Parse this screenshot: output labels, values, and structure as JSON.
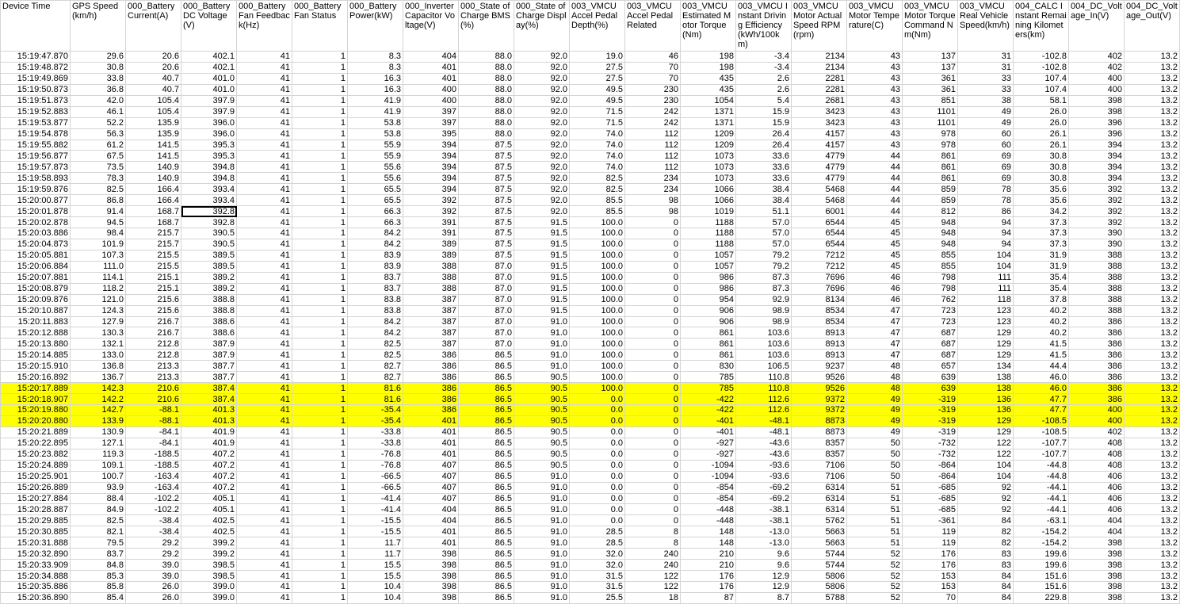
{
  "sheet": {
    "headers": [
      "Device Time",
      "GPS Speed(km/h)",
      "000_Battery Current(A)",
      "000_Battery DC Voltage(V)",
      "000_Battery Fan Feedback(Hz)",
      "000_Battery Fan Status",
      "000_Battery Power(kW)",
      "000_Inverter Capacitor Voltage(V)",
      "000_State of Charge BMS(%)",
      "000_State of Charge Display(%)",
      "003_VMCU Accel Pedal Depth(%)",
      "003_VMCU Accel Pedal Related",
      "003_VMCU Estimated Motor Torque(Nm)",
      "003_VMCU Instant Driving Efficiency(kWh/100km)",
      "003_VMCU Motor Actual Speed RPM(rpm)",
      "003_VMCU Motor Temperature(C)",
      "003_VMCU Motor Torque Command Nm(Nm)",
      "003_VMCU Real Vehicle Speed(km/h)",
      "004_CALC Instant Remaining Kilometers(km)",
      "004_DC_Voltage_In(V)",
      "004_DC_Voltage_Out(V)"
    ],
    "highlight_color": "#ffff00",
    "highlighted_rows": [
      30,
      31,
      32,
      33
    ],
    "selected_cell": {
      "row": 14,
      "col": 3
    },
    "rows": [
      [
        "15:19:47.870",
        "29.6",
        "20.6",
        "402.1",
        "41",
        "1",
        "8.3",
        "404",
        "88.0",
        "92.0",
        "19.0",
        "46",
        "198",
        "-3.4",
        "2134",
        "43",
        "137",
        "31",
        "-102.8",
        "402",
        "13.2"
      ],
      [
        "15:19:48.872",
        "30.8",
        "20.6",
        "402.1",
        "41",
        "1",
        "8.3",
        "401",
        "88.0",
        "92.0",
        "27.5",
        "70",
        "198",
        "-3.4",
        "2134",
        "43",
        "137",
        "31",
        "-102.8",
        "402",
        "13.2"
      ],
      [
        "15:19:49.869",
        "33.8",
        "40.7",
        "401.0",
        "41",
        "1",
        "16.3",
        "401",
        "88.0",
        "92.0",
        "27.5",
        "70",
        "435",
        "2.6",
        "2281",
        "43",
        "361",
        "33",
        "107.4",
        "400",
        "13.2"
      ],
      [
        "15:19:50.873",
        "36.8",
        "40.7",
        "401.0",
        "41",
        "1",
        "16.3",
        "400",
        "88.0",
        "92.0",
        "49.5",
        "230",
        "435",
        "2.6",
        "2281",
        "43",
        "361",
        "33",
        "107.4",
        "400",
        "13.2"
      ],
      [
        "15:19:51.873",
        "42.0",
        "105.4",
        "397.9",
        "41",
        "1",
        "41.9",
        "400",
        "88.0",
        "92.0",
        "49.5",
        "230",
        "1054",
        "5.4",
        "2681",
        "43",
        "851",
        "38",
        "58.1",
        "398",
        "13.2"
      ],
      [
        "15:19:52.883",
        "46.1",
        "105.4",
        "397.9",
        "41",
        "1",
        "41.9",
        "397",
        "88.0",
        "92.0",
        "71.5",
        "242",
        "1371",
        "15.9",
        "3423",
        "43",
        "1101",
        "49",
        "26.0",
        "398",
        "13.2"
      ],
      [
        "15:19:53.877",
        "52.2",
        "135.9",
        "396.0",
        "41",
        "1",
        "53.8",
        "397",
        "88.0",
        "92.0",
        "71.5",
        "242",
        "1371",
        "15.9",
        "3423",
        "43",
        "1101",
        "49",
        "26.0",
        "396",
        "13.2"
      ],
      [
        "15:19:54.878",
        "56.3",
        "135.9",
        "396.0",
        "41",
        "1",
        "53.8",
        "395",
        "88.0",
        "92.0",
        "74.0",
        "112",
        "1209",
        "26.4",
        "4157",
        "43",
        "978",
        "60",
        "26.1",
        "396",
        "13.2"
      ],
      [
        "15:19:55.882",
        "61.2",
        "141.5",
        "395.3",
        "41",
        "1",
        "55.9",
        "394",
        "87.5",
        "92.0",
        "74.0",
        "112",
        "1209",
        "26.4",
        "4157",
        "43",
        "978",
        "60",
        "26.1",
        "394",
        "13.2"
      ],
      [
        "15:19:56.877",
        "67.5",
        "141.5",
        "395.3",
        "41",
        "1",
        "55.9",
        "394",
        "87.5",
        "92.0",
        "74.0",
        "112",
        "1073",
        "33.6",
        "4779",
        "44",
        "861",
        "69",
        "30.8",
        "394",
        "13.2"
      ],
      [
        "15:19:57.873",
        "73.5",
        "140.9",
        "394.8",
        "41",
        "1",
        "55.6",
        "394",
        "87.5",
        "92.0",
        "74.0",
        "112",
        "1073",
        "33.6",
        "4779",
        "44",
        "861",
        "69",
        "30.8",
        "394",
        "13.2"
      ],
      [
        "15:19:58.893",
        "78.3",
        "140.9",
        "394.8",
        "41",
        "1",
        "55.6",
        "394",
        "87.5",
        "92.0",
        "82.5",
        "234",
        "1073",
        "33.6",
        "4779",
        "44",
        "861",
        "69",
        "30.8",
        "394",
        "13.2"
      ],
      [
        "15:19:59.876",
        "82.5",
        "166.4",
        "393.4",
        "41",
        "1",
        "65.5",
        "394",
        "87.5",
        "92.0",
        "82.5",
        "234",
        "1066",
        "38.4",
        "5468",
        "44",
        "859",
        "78",
        "35.6",
        "392",
        "13.2"
      ],
      [
        "15:20:00.877",
        "86.8",
        "166.4",
        "393.4",
        "41",
        "1",
        "65.5",
        "392",
        "87.5",
        "92.0",
        "85.5",
        "98",
        "1066",
        "38.4",
        "5468",
        "44",
        "859",
        "78",
        "35.6",
        "392",
        "13.2"
      ],
      [
        "15:20:01.878",
        "91.4",
        "168.7",
        "392.8",
        "41",
        "1",
        "66.3",
        "392",
        "87.5",
        "92.0",
        "85.5",
        "98",
        "1019",
        "51.1",
        "6001",
        "44",
        "812",
        "86",
        "34.2",
        "392",
        "13.2"
      ],
      [
        "15:20:02.878",
        "94.5",
        "168.7",
        "392.8",
        "41",
        "1",
        "66.3",
        "391",
        "87.5",
        "91.5",
        "100.0",
        "0",
        "1188",
        "57.0",
        "6544",
        "45",
        "948",
        "94",
        "37.3",
        "392",
        "13.2"
      ],
      [
        "15:20:03.886",
        "98.4",
        "215.7",
        "390.5",
        "41",
        "1",
        "84.2",
        "391",
        "87.5",
        "91.5",
        "100.0",
        "0",
        "1188",
        "57.0",
        "6544",
        "45",
        "948",
        "94",
        "37.3",
        "390",
        "13.2"
      ],
      [
        "15:20:04.873",
        "101.9",
        "215.7",
        "390.5",
        "41",
        "1",
        "84.2",
        "389",
        "87.5",
        "91.5",
        "100.0",
        "0",
        "1188",
        "57.0",
        "6544",
        "45",
        "948",
        "94",
        "37.3",
        "390",
        "13.2"
      ],
      [
        "15:20:05.881",
        "107.3",
        "215.5",
        "389.5",
        "41",
        "1",
        "83.9",
        "389",
        "87.5",
        "91.5",
        "100.0",
        "0",
        "1057",
        "79.2",
        "7212",
        "45",
        "855",
        "104",
        "31.9",
        "388",
        "13.2"
      ],
      [
        "15:20:06.884",
        "111.0",
        "215.5",
        "389.5",
        "41",
        "1",
        "83.9",
        "388",
        "87.0",
        "91.5",
        "100.0",
        "0",
        "1057",
        "79.2",
        "7212",
        "45",
        "855",
        "104",
        "31.9",
        "388",
        "13.2"
      ],
      [
        "15:20:07.881",
        "114.1",
        "215.1",
        "389.2",
        "41",
        "1",
        "83.7",
        "388",
        "87.0",
        "91.5",
        "100.0",
        "0",
        "986",
        "87.3",
        "7696",
        "46",
        "798",
        "111",
        "35.4",
        "388",
        "13.2"
      ],
      [
        "15:20:08.879",
        "118.2",
        "215.1",
        "389.2",
        "41",
        "1",
        "83.7",
        "388",
        "87.0",
        "91.5",
        "100.0",
        "0",
        "986",
        "87.3",
        "7696",
        "46",
        "798",
        "111",
        "35.4",
        "388",
        "13.2"
      ],
      [
        "15:20:09.876",
        "121.0",
        "215.6",
        "388.8",
        "41",
        "1",
        "83.8",
        "387",
        "87.0",
        "91.5",
        "100.0",
        "0",
        "954",
        "92.9",
        "8134",
        "46",
        "762",
        "118",
        "37.8",
        "388",
        "13.2"
      ],
      [
        "15:20:10.887",
        "124.3",
        "215.6",
        "388.8",
        "41",
        "1",
        "83.8",
        "387",
        "87.0",
        "91.5",
        "100.0",
        "0",
        "906",
        "98.9",
        "8534",
        "47",
        "723",
        "123",
        "40.2",
        "388",
        "13.2"
      ],
      [
        "15:20:11.883",
        "127.9",
        "216.7",
        "388.6",
        "41",
        "1",
        "84.2",
        "387",
        "87.0",
        "91.0",
        "100.0",
        "0",
        "906",
        "98.9",
        "8534",
        "47",
        "723",
        "123",
        "40.2",
        "386",
        "13.2"
      ],
      [
        "15:20:12.888",
        "130.3",
        "216.7",
        "388.6",
        "41",
        "1",
        "84.2",
        "387",
        "87.0",
        "91.0",
        "100.0",
        "0",
        "861",
        "103.6",
        "8913",
        "47",
        "687",
        "129",
        "40.2",
        "386",
        "13.2"
      ],
      [
        "15:20:13.880",
        "132.1",
        "212.8",
        "387.9",
        "41",
        "1",
        "82.5",
        "387",
        "87.0",
        "91.0",
        "100.0",
        "0",
        "861",
        "103.6",
        "8913",
        "47",
        "687",
        "129",
        "41.5",
        "386",
        "13.2"
      ],
      [
        "15:20:14.885",
        "133.0",
        "212.8",
        "387.9",
        "41",
        "1",
        "82.5",
        "386",
        "86.5",
        "91.0",
        "100.0",
        "0",
        "861",
        "103.6",
        "8913",
        "47",
        "687",
        "129",
        "41.5",
        "386",
        "13.2"
      ],
      [
        "15:20:15.910",
        "136.8",
        "213.3",
        "387.7",
        "41",
        "1",
        "82.7",
        "386",
        "86.5",
        "91.0",
        "100.0",
        "0",
        "830",
        "106.5",
        "9237",
        "48",
        "657",
        "134",
        "44.4",
        "386",
        "13.2"
      ],
      [
        "15:20:16.892",
        "136.7",
        "213.3",
        "387.7",
        "41",
        "1",
        "82.7",
        "386",
        "86.5",
        "90.5",
        "100.0",
        "0",
        "785",
        "110.8",
        "9526",
        "48",
        "639",
        "138",
        "46.0",
        "386",
        "13.2"
      ],
      [
        "15:20:17.889",
        "142.3",
        "210.6",
        "387.4",
        "41",
        "1",
        "81.6",
        "386",
        "86.5",
        "90.5",
        "100.0",
        "0",
        "785",
        "110.8",
        "9526",
        "48",
        "639",
        "138",
        "46.0",
        "386",
        "13.2"
      ],
      [
        "15:20:18.907",
        "142.2",
        "210.6",
        "387.4",
        "41",
        "1",
        "81.6",
        "386",
        "86.5",
        "90.5",
        "0.0",
        "0",
        "-422",
        "112.6",
        "9372",
        "49",
        "-319",
        "136",
        "47.7",
        "386",
        "13.2"
      ],
      [
        "15:20:19.880",
        "142.7",
        "-88.1",
        "401.3",
        "41",
        "1",
        "-35.4",
        "386",
        "86.5",
        "90.5",
        "0.0",
        "0",
        "-422",
        "112.6",
        "9372",
        "49",
        "-319",
        "136",
        "47.7",
        "400",
        "13.2"
      ],
      [
        "15:20:20.880",
        "133.9",
        "-88.1",
        "401.3",
        "41",
        "1",
        "-35.4",
        "401",
        "86.5",
        "90.5",
        "0.0",
        "0",
        "-401",
        "-48.1",
        "8873",
        "49",
        "-319",
        "129",
        "-108.5",
        "400",
        "13.2"
      ],
      [
        "15:20:21.889",
        "130.9",
        "-84.1",
        "401.9",
        "41",
        "1",
        "-33.8",
        "401",
        "86.5",
        "90.5",
        "0.0",
        "0",
        "-401",
        "-48.1",
        "8873",
        "49",
        "-319",
        "129",
        "-108.5",
        "402",
        "13.2"
      ],
      [
        "15:20:22.895",
        "127.1",
        "-84.1",
        "401.9",
        "41",
        "1",
        "-33.8",
        "401",
        "86.5",
        "90.5",
        "0.0",
        "0",
        "-927",
        "-43.6",
        "8357",
        "50",
        "-732",
        "122",
        "-107.7",
        "408",
        "13.2"
      ],
      [
        "15:20:23.882",
        "119.3",
        "-188.5",
        "407.2",
        "41",
        "1",
        "-76.8",
        "401",
        "86.5",
        "90.5",
        "0.0",
        "0",
        "-927",
        "-43.6",
        "8357",
        "50",
        "-732",
        "122",
        "-107.7",
        "408",
        "13.2"
      ],
      [
        "15:20:24.889",
        "109.1",
        "-188.5",
        "407.2",
        "41",
        "1",
        "-76.8",
        "407",
        "86.5",
        "90.5",
        "0.0",
        "0",
        "-1094",
        "-93.6",
        "7106",
        "50",
        "-864",
        "104",
        "-44.8",
        "408",
        "13.2"
      ],
      [
        "15:20:25.901",
        "100.7",
        "-163.4",
        "407.2",
        "41",
        "1",
        "-66.5",
        "407",
        "86.5",
        "91.0",
        "0.0",
        "0",
        "-1094",
        "-93.6",
        "7106",
        "50",
        "-864",
        "104",
        "-44.8",
        "406",
        "13.2"
      ],
      [
        "15:20:26.889",
        "93.9",
        "-163.4",
        "407.2",
        "41",
        "1",
        "-66.5",
        "407",
        "86.5",
        "91.0",
        "0.0",
        "0",
        "-854",
        "-69.2",
        "6314",
        "51",
        "-685",
        "92",
        "-44.1",
        "406",
        "13.2"
      ],
      [
        "15:20:27.884",
        "88.4",
        "-102.2",
        "405.1",
        "41",
        "1",
        "-41.4",
        "407",
        "86.5",
        "91.0",
        "0.0",
        "0",
        "-854",
        "-69.2",
        "6314",
        "51",
        "-685",
        "92",
        "-44.1",
        "406",
        "13.2"
      ],
      [
        "15:20:28.887",
        "84.9",
        "-102.2",
        "405.1",
        "41",
        "1",
        "-41.4",
        "404",
        "86.5",
        "91.0",
        "0.0",
        "0",
        "-448",
        "-38.1",
        "6314",
        "51",
        "-685",
        "92",
        "-44.1",
        "406",
        "13.2"
      ],
      [
        "15:20:29.885",
        "82.5",
        "-38.4",
        "402.5",
        "41",
        "1",
        "-15.5",
        "404",
        "86.5",
        "91.0",
        "0.0",
        "0",
        "-448",
        "-38.1",
        "5762",
        "51",
        "-361",
        "84",
        "-63.1",
        "404",
        "13.2"
      ],
      [
        "15:20:30.885",
        "82.1",
        "-38.4",
        "402.5",
        "41",
        "1",
        "-15.5",
        "401",
        "86.5",
        "91.0",
        "28.5",
        "8",
        "148",
        "-13.0",
        "5663",
        "51",
        "119",
        "82",
        "-154.2",
        "404",
        "13.2"
      ],
      [
        "15:20:31.888",
        "79.5",
        "29.2",
        "399.2",
        "41",
        "1",
        "11.7",
        "401",
        "86.5",
        "91.0",
        "28.5",
        "8",
        "148",
        "-13.0",
        "5663",
        "51",
        "119",
        "82",
        "-154.2",
        "398",
        "13.2"
      ],
      [
        "15:20:32.890",
        "83.7",
        "29.2",
        "399.2",
        "41",
        "1",
        "11.7",
        "398",
        "86.5",
        "91.0",
        "32.0",
        "240",
        "210",
        "9.6",
        "5744",
        "52",
        "176",
        "83",
        "199.6",
        "398",
        "13.2"
      ],
      [
        "15:20:33.909",
        "84.8",
        "39.0",
        "398.5",
        "41",
        "1",
        "15.5",
        "398",
        "86.5",
        "91.0",
        "32.0",
        "240",
        "210",
        "9.6",
        "5744",
        "52",
        "176",
        "83",
        "199.6",
        "398",
        "13.2"
      ],
      [
        "15:20:34.888",
        "85.3",
        "39.0",
        "398.5",
        "41",
        "1",
        "15.5",
        "398",
        "86.5",
        "91.0",
        "31.5",
        "122",
        "176",
        "12.9",
        "5806",
        "52",
        "153",
        "84",
        "151.6",
        "398",
        "13.2"
      ],
      [
        "15:20:35.886",
        "85.8",
        "26.0",
        "399.0",
        "41",
        "1",
        "10.4",
        "398",
        "86.5",
        "91.0",
        "31.5",
        "122",
        "176",
        "12.9",
        "5806",
        "52",
        "153",
        "84",
        "151.6",
        "398",
        "13.2"
      ],
      [
        "15:20:36.890",
        "85.4",
        "26.0",
        "399.0",
        "41",
        "1",
        "10.4",
        "398",
        "86.5",
        "91.0",
        "25.5",
        "18",
        "87",
        "8.7",
        "5788",
        "52",
        "70",
        "84",
        "229.8",
        "398",
        "13.2"
      ]
    ]
  }
}
